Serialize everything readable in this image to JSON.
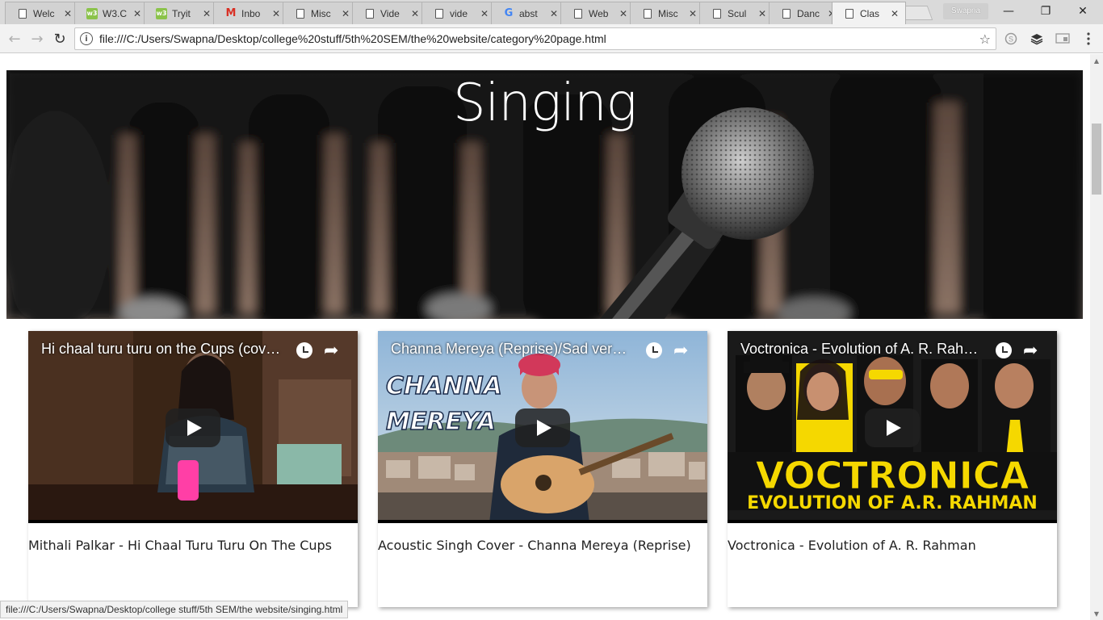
{
  "browser": {
    "tabs": [
      {
        "title": "Welc",
        "icon": "document-icon"
      },
      {
        "title": "W3.C",
        "icon": "w3schools-icon"
      },
      {
        "title": "Tryit",
        "icon": "w3schools-icon"
      },
      {
        "title": "Inbo",
        "icon": "gmail-icon"
      },
      {
        "title": "Misc",
        "icon": "document-icon"
      },
      {
        "title": "Vide",
        "icon": "document-icon"
      },
      {
        "title": "vide",
        "icon": "document-icon"
      },
      {
        "title": "abst",
        "icon": "google-icon"
      },
      {
        "title": "Web",
        "icon": "document-icon"
      },
      {
        "title": "Misc",
        "icon": "document-icon"
      },
      {
        "title": "Scul",
        "icon": "document-icon"
      },
      {
        "title": "Danc",
        "icon": "document-icon"
      },
      {
        "title": "Clas",
        "icon": "document-icon",
        "active": true
      }
    ],
    "profile_name": "Swapna",
    "window_controls": {
      "minimize": "—",
      "restore": "❐",
      "close": "✕"
    },
    "address": "file:///C:/Users/Swapna/Desktop/college%20stuff/5th%20SEM/the%20website/category%20page.html",
    "status_url": "file:///C:/Users/Swapna/Desktop/college stuff/5th SEM/the website/singing.html"
  },
  "page": {
    "hero_title": "Singing",
    "videos": [
      {
        "title": "Hi chaal turu turu on the Cups (cover)",
        "caption": "Mithali Palkar - Hi Chaal Turu Turu On The Cups"
      },
      {
        "title": "Channa Mereya (Reprise)/Sad version...",
        "caption": "Acoustic Singh Cover - Channa Mereya (Reprise)",
        "thumb_text_1": "CHANNA",
        "thumb_text_2": "MEREYA"
      },
      {
        "title": "Voctronica - Evolution of A. R. Rahm...",
        "caption": "Voctronica - Evolution of A. R. Rahman",
        "thumb_text_1": "VOCTRONICA",
        "thumb_text_2": "EVOLUTION OF A.R. RAHMAN"
      }
    ]
  },
  "colors": {
    "chrome_tab_bg": "#d2d2d2",
    "toolbar_bg": "#f2f2f2",
    "voctronica_yellow": "#f5d800"
  }
}
